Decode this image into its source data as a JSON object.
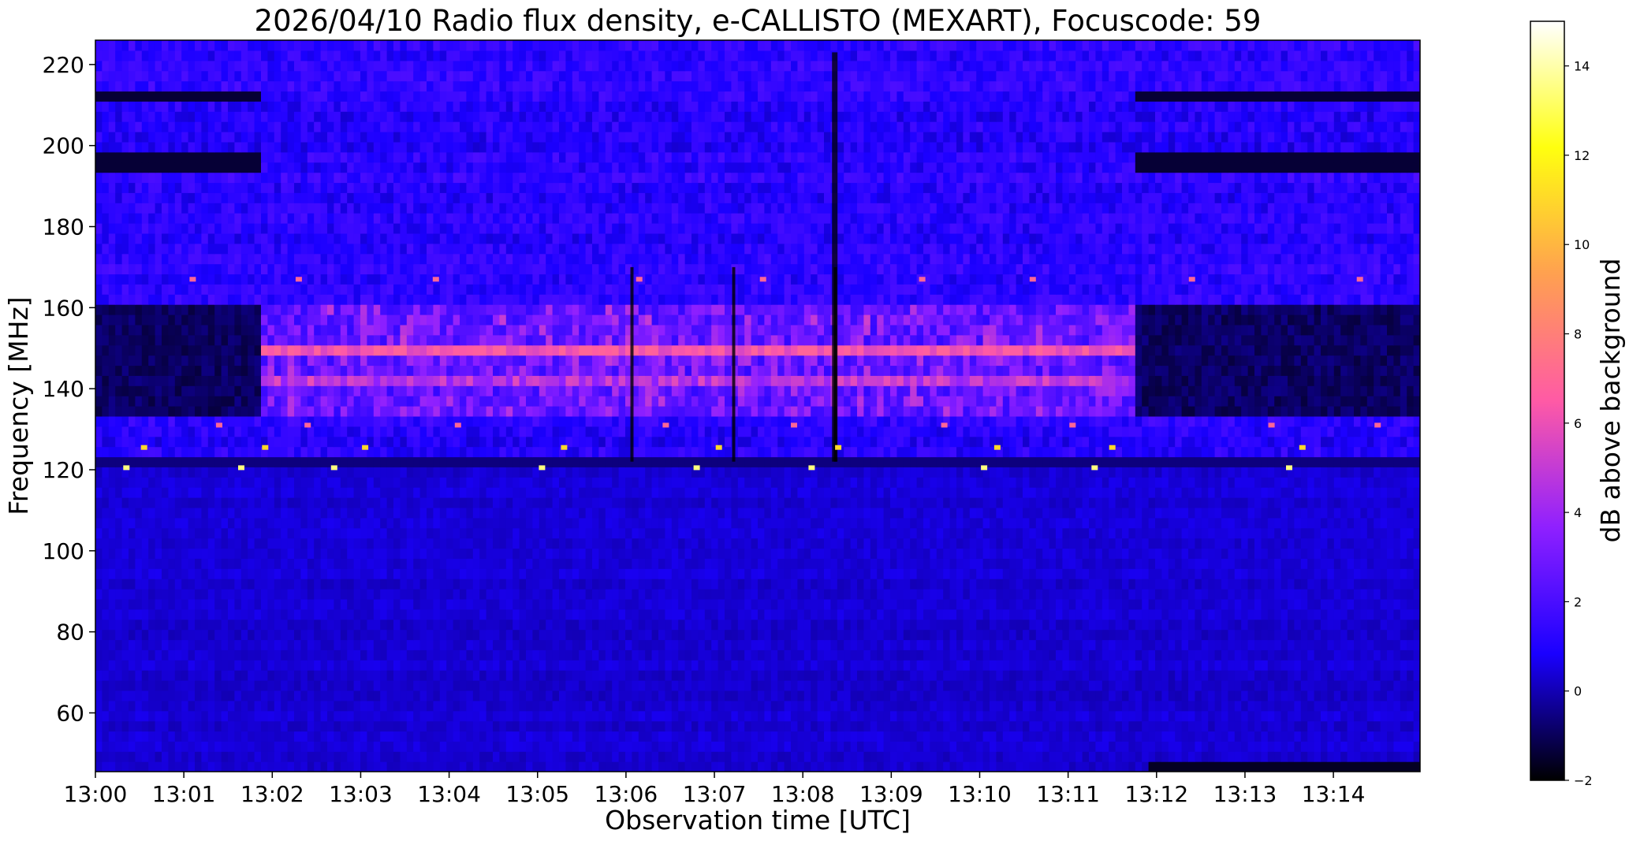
{
  "chart_data": {
    "type": "heatmap",
    "title": "2026/04/10  Radio flux density, e-CALLISTO (MEXART), Focuscode: 59",
    "xlabel": "Observation time [UTC]",
    "ylabel": "Frequency [MHz]",
    "x_ticks": [
      "13:00",
      "13:01",
      "13:02",
      "13:03",
      "13:04",
      "13:05",
      "13:06",
      "13:07",
      "13:08",
      "13:09",
      "13:10",
      "13:11",
      "13:12",
      "13:13",
      "13:14"
    ],
    "xlim_minutes": [
      0,
      14.98
    ],
    "y_ticks": [
      60,
      80,
      100,
      120,
      140,
      160,
      180,
      200,
      220
    ],
    "ylim": [
      45.5,
      226
    ],
    "colorbar": {
      "label": "dB above background",
      "ticks": [
        -2,
        0,
        2,
        4,
        6,
        8,
        10,
        12,
        14
      ],
      "range": [
        -2,
        15
      ],
      "colormap": "gnuplot2",
      "colors": [
        "#000000",
        "#1a00ff",
        "#8f20ff",
        "#ff5aa5",
        "#ffa050",
        "#ffff0f",
        "#ffffff"
      ]
    },
    "features": {
      "interference_band_MHz": [
        132,
        155
      ],
      "strong_line_MHz": 150.5,
      "secondary_line_MHz": 141,
      "quiet_period_before_minutes": [
        0,
        1.9
      ],
      "quiet_period_after_minutes": [
        11.75,
        14.98
      ],
      "hot_dots_MHz": [
        120.5,
        125.5,
        167,
        131
      ]
    }
  }
}
